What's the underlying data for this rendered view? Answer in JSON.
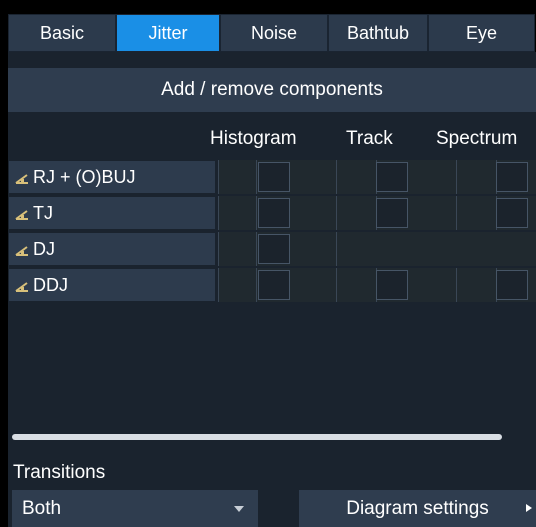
{
  "tabs": [
    "Basic",
    "Jitter",
    "Noise",
    "Bathtub",
    "Eye"
  ],
  "active_tab": "Jitter",
  "add_remove_label": "Add / remove components",
  "columns": [
    "Histogram",
    "Track",
    "Spectrum"
  ],
  "rows": [
    {
      "label": "RJ + (O)BUJ",
      "checkboxes": {
        "histogram": false,
        "track": false,
        "spectrum": false
      }
    },
    {
      "label": "TJ",
      "checkboxes": {
        "histogram": false,
        "track": false,
        "spectrum": false
      }
    },
    {
      "label": "DJ",
      "checkboxes": {
        "histogram": false
      }
    },
    {
      "label": "DDJ",
      "checkboxes": {
        "histogram": false,
        "track": false,
        "spectrum": false
      }
    }
  ],
  "transitions": {
    "label": "Transitions",
    "value": "Both"
  },
  "diagram_settings_label": "Diagram settings",
  "colors": {
    "active_tab": "#1a8fe6",
    "tab": "#2c3a4c",
    "panel": "#1a232e",
    "row": "#2d3b4d",
    "icon": "#d8c07a"
  }
}
